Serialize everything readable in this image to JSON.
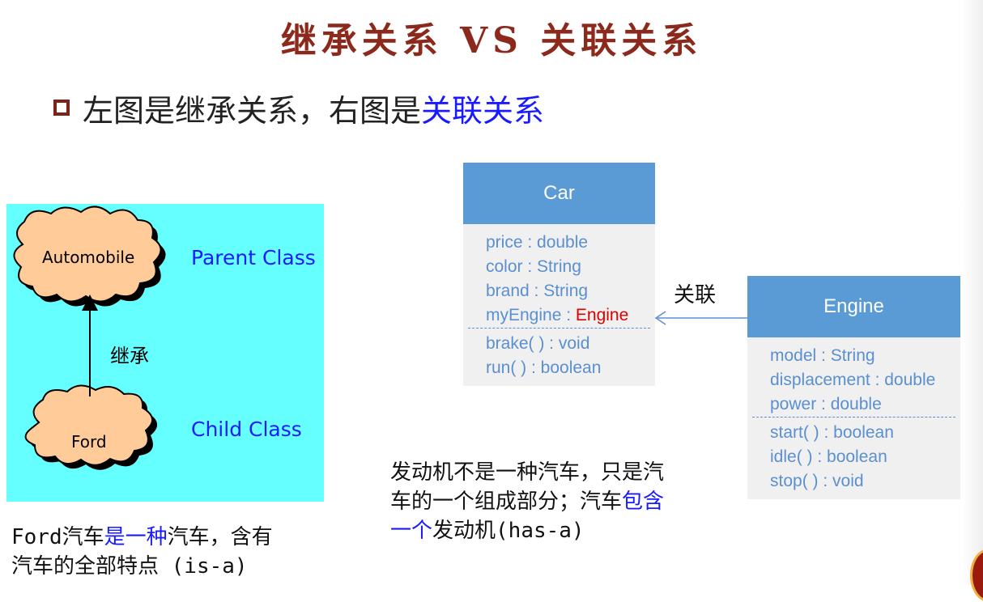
{
  "title": "继承关系 VS 关联关系",
  "subtitle": {
    "prefix": "左图是继承关系，右图是",
    "highlight": "关联关系"
  },
  "inheritance": {
    "parent_cloud": "Automobile",
    "child_cloud": "Ford",
    "parent_role": "Parent Class",
    "child_role": "Child Class",
    "arrow_label": "继承",
    "caption": {
      "part1": "Ford汽车",
      "highlight": "是一种",
      "part2": "汽车，含有",
      "line2": "汽车的全部特点 (is-a)"
    }
  },
  "association": {
    "label": "关联",
    "car": {
      "name": "Car",
      "attributes": [
        "price : double",
        "color : String",
        "brand : String"
      ],
      "attr_special_prefix": "myEngine : ",
      "attr_special_type": "Engine",
      "operations": [
        "brake( ) : void",
        "run( ) : boolean"
      ]
    },
    "engine": {
      "name": "Engine",
      "attributes": [
        "model : String",
        "displacement : double",
        "power : double"
      ],
      "operations": [
        "start( ) : boolean",
        "idle( ) : boolean",
        "stop( ) : void"
      ]
    },
    "note": {
      "line1": "发动机不是一种汽车，只是汽",
      "line2_prefix": "车的一个组成部分；汽车",
      "line2_highlight": "包含",
      "line3_highlight": "一个",
      "line3_suffix": "发动机(has-a)"
    }
  },
  "colors": {
    "title": "#8b2a1c",
    "highlight": "#1a1aff",
    "uml_header": "#5a9bd5",
    "uml_text": "#5a8fd0",
    "inherit_bg": "#66ffff",
    "cloud_fill": "#ffcc99"
  }
}
